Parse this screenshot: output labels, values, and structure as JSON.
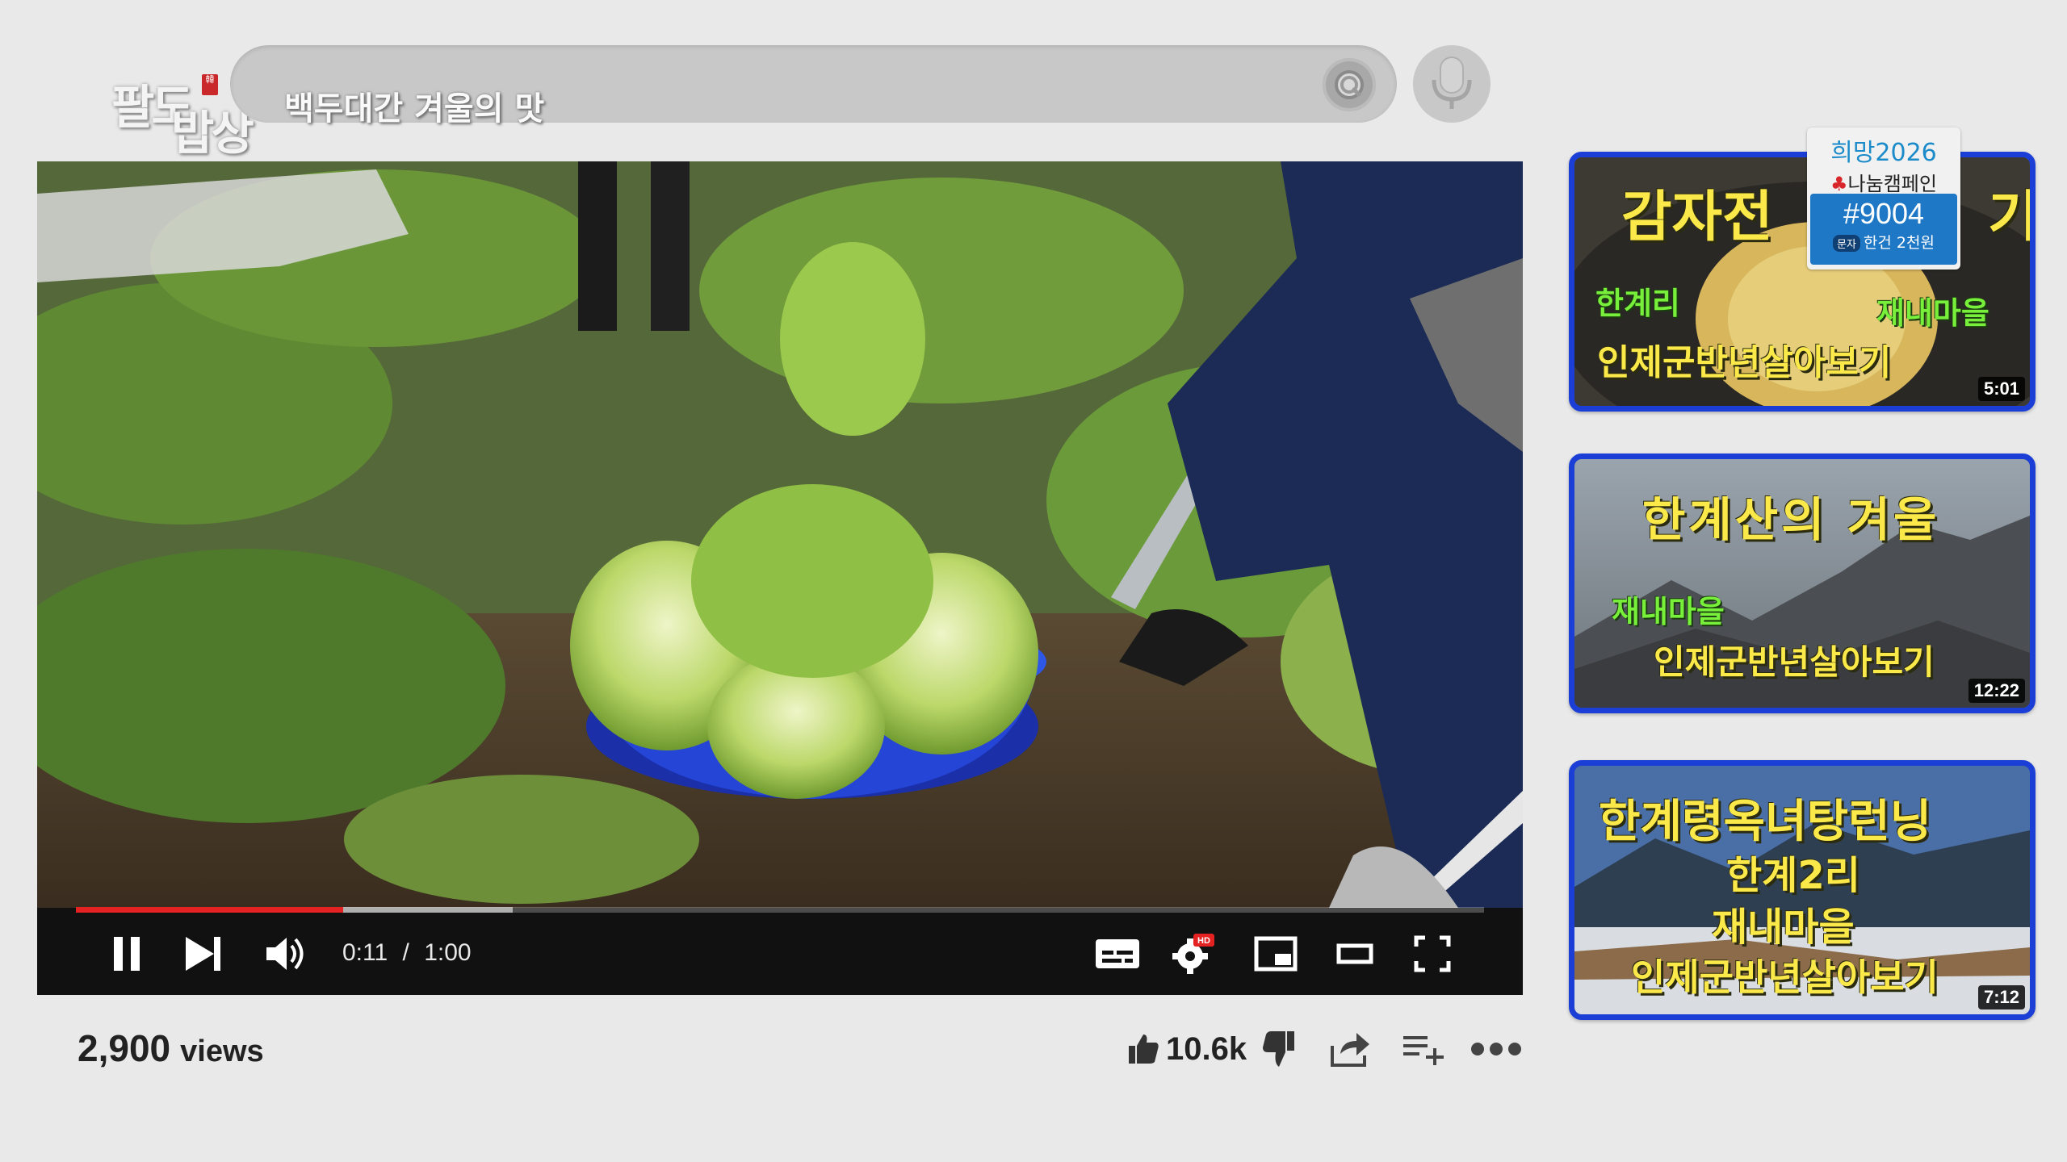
{
  "branding": {
    "logo_line1": "팔도",
    "logo_line2": "밥상",
    "logo_seal": "韓",
    "subtitle": "백두대간 겨울의 맛"
  },
  "search": {
    "placeholder": "",
    "value": ""
  },
  "player": {
    "current_time": "0:11",
    "separator": "/",
    "duration": "1:00",
    "progress_fraction": 0.19,
    "buffered_fraction": 0.31,
    "hd_badge": "HD",
    "accent_color": "#e52222"
  },
  "meta": {
    "views_count": "2,900",
    "views_label": "views",
    "like_count": "10.6k"
  },
  "sidebar": {
    "items": [
      {
        "title_main": "감자전",
        "title_suffix": "기",
        "line_left": "한계리",
        "line_right": "재내마을",
        "line_bottom": "인제군반년살아보기",
        "duration": "5:01"
      },
      {
        "title_main": "한계산의 겨울",
        "line_left": "재내마을",
        "line_bottom": "인제군반년살아보기",
        "duration": "12:22"
      },
      {
        "title_main": "한계령옥녀탕런닝",
        "line_2": "한계2리",
        "line_3": "재내마을",
        "line_bottom": "인제군반년살아보기",
        "duration": "7:12"
      }
    ]
  },
  "campaign": {
    "line1": "희망2026",
    "line2": "나눔캠페인",
    "code": "#9004",
    "sms_tag": "문자",
    "note": "한건 2천원"
  },
  "colors": {
    "thumb_border": "#1b3fd6",
    "title_yellow": "#fbe94a",
    "title_green": "#78f03b",
    "campaign_blue": "#1f78c6"
  }
}
